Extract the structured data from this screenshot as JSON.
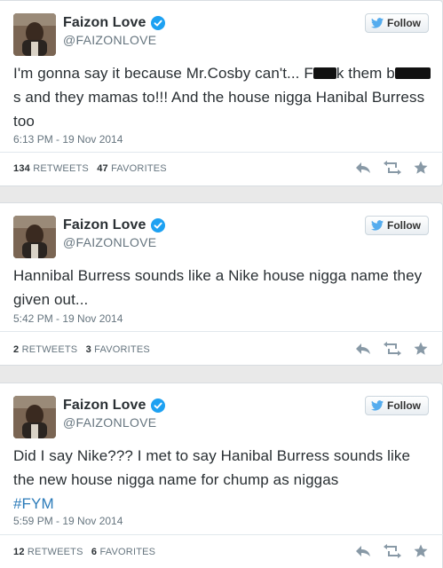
{
  "colors": {
    "background": "#e9e9e9",
    "card": "#ffffff",
    "verified": "#1da1f2",
    "hashtag": "#2b7bb9",
    "muted": "#66757f",
    "twitter_bird": "#55acee"
  },
  "tweets": [
    {
      "display_name": "Faizon Love",
      "handle": "@FAIZONLOVE",
      "follow_label": "Follow",
      "text_part1": "I'm gonna say it because Mr.Cosby can't... F",
      "text_part2": "k them",
      "text_part3": "b",
      "text_part4": "s and they mamas to!!! And the house nigga Hanibal Burress too",
      "timestamp": "6:13 PM - 19 Nov 2014",
      "retweets_count": "134",
      "retweets_label": "RETWEETS",
      "favorites_count": "47",
      "favorites_label": "FAVORITES"
    },
    {
      "display_name": "Faizon Love",
      "handle": "@FAIZONLOVE",
      "follow_label": "Follow",
      "text": "Hannibal Burress sounds like a Nike house nigga name they given out...",
      "timestamp": "5:42 PM - 19 Nov 2014",
      "retweets_count": "2",
      "retweets_label": "RETWEETS",
      "favorites_count": "3",
      "favorites_label": "FAVORITES"
    },
    {
      "display_name": "Faizon Love",
      "handle": "@FAIZONLOVE",
      "follow_label": "Follow",
      "text": "Did I say Nike??? I met to say Hanibal Burress sounds like the new house nigga name for chump as niggas",
      "hashtag": "#FYM",
      "timestamp": "5:59 PM - 19 Nov 2014",
      "retweets_count": "12",
      "retweets_label": "RETWEETS",
      "favorites_count": "6",
      "favorites_label": "FAVORITES"
    }
  ],
  "icons": {
    "avatar": "profile-photo",
    "verified": "verified-badge-icon",
    "follow": "twitter-bird-icon",
    "reply": "reply-icon",
    "retweet": "retweet-icon",
    "favorite": "star-icon"
  }
}
